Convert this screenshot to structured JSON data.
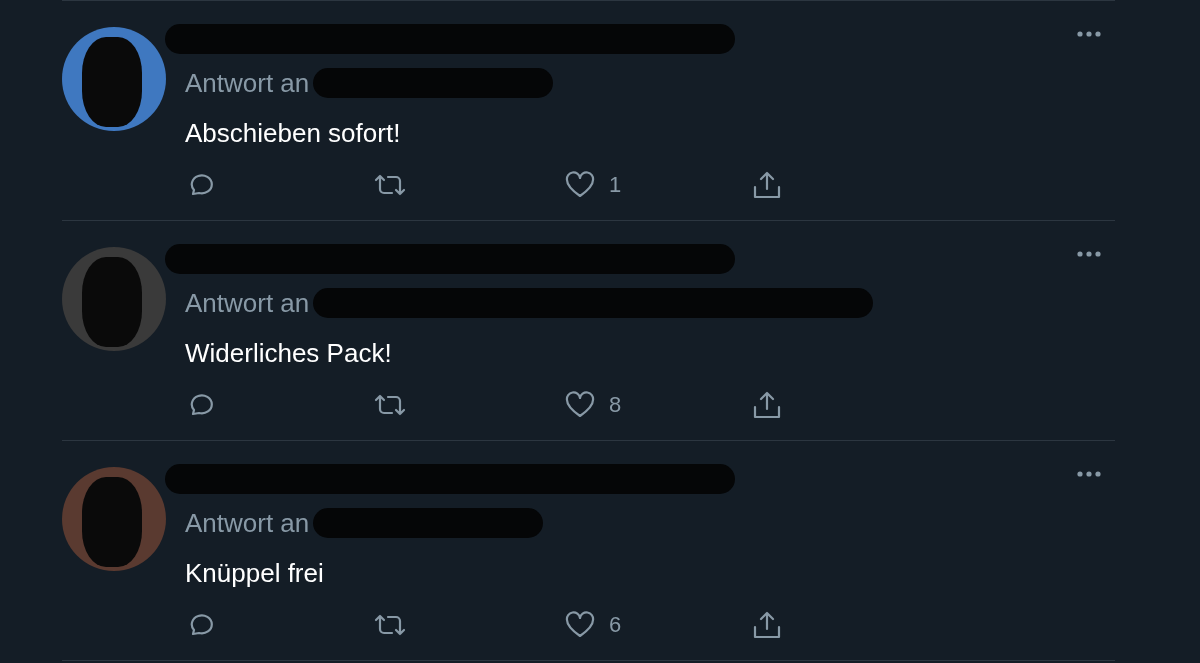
{
  "tweets": [
    {
      "reply_prefix": "Antwort an",
      "text": "Abschieben sofort!",
      "like_count": "1"
    },
    {
      "reply_prefix": "Antwort an",
      "text": "Widerliches Pack!",
      "like_count": "8"
    },
    {
      "reply_prefix": "Antwort an",
      "text": "Knüppel frei",
      "like_count": "6"
    }
  ]
}
